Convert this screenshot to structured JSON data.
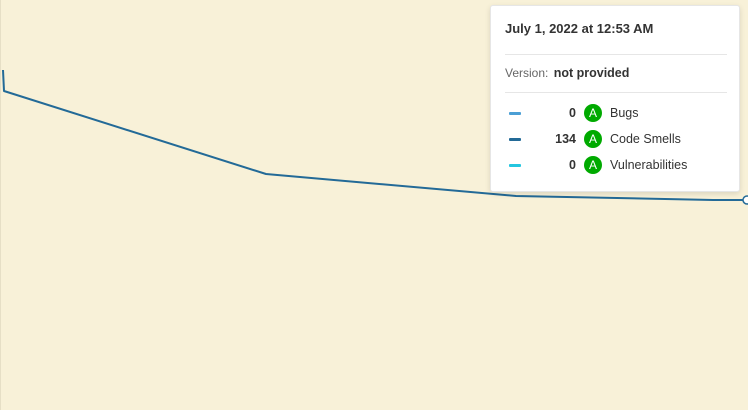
{
  "tooltip": {
    "date": "July 1, 2022 at 12:53 AM",
    "version_label": "Version:",
    "version_value": "not provided",
    "metrics": [
      {
        "value": "0",
        "rating": "A",
        "label": "Bugs",
        "swatch_color": "#4b9fd5"
      },
      {
        "value": "134",
        "rating": "A",
        "label": "Code Smells",
        "swatch_color": "#236a97"
      },
      {
        "value": "0",
        "rating": "A",
        "label": "Vulnerabilities",
        "swatch_color": "#24c6e0"
      }
    ],
    "rating_color": "#00aa00"
  },
  "colors": {
    "background": "#f8f1d8",
    "line": "#236a97"
  },
  "chart_data": {
    "type": "line",
    "series": [
      {
        "values": [
          134
        ]
      }
    ],
    "grid": false
  }
}
